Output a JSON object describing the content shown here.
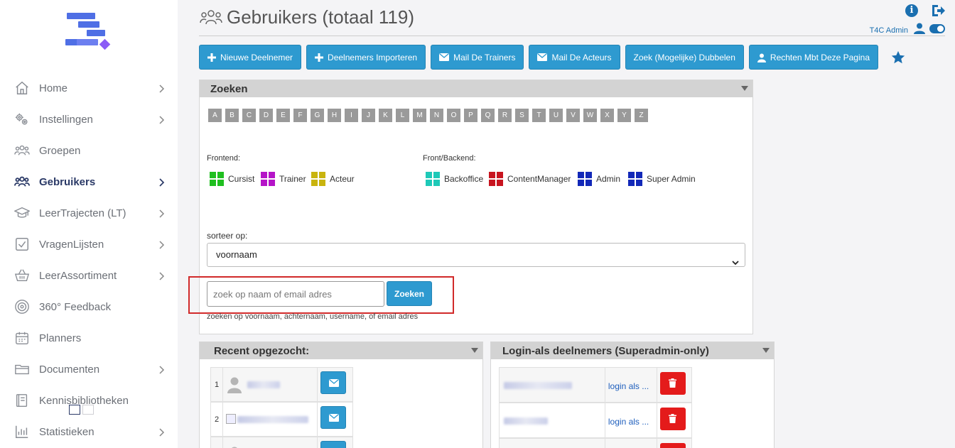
{
  "sidebar": {
    "items": [
      {
        "label": "Home"
      },
      {
        "label": "Instellingen"
      },
      {
        "label": "Groepen"
      },
      {
        "label": "Gebruikers"
      },
      {
        "label": "LeerTrajecten (LT)"
      },
      {
        "label": "VragenLijsten"
      },
      {
        "label": "LeerAssortiment"
      },
      {
        "label": "360° Feedback"
      },
      {
        "label": "Planners"
      },
      {
        "label": "Documenten"
      },
      {
        "label": "Kennisbibliotheken"
      },
      {
        "label": "Statistieken"
      }
    ],
    "active": "Gebruikers"
  },
  "header": {
    "title": "Gebruikers (totaal 119)",
    "user_name": "T4C Admin"
  },
  "toolbar": {
    "buttons": [
      {
        "label": "Nieuwe Deelnemer",
        "icon": "plus-icon"
      },
      {
        "label": "Deelnemers Importeren",
        "icon": "plus-icon"
      },
      {
        "label": "Mail De Trainers",
        "icon": "envelope-icon"
      },
      {
        "label": "Mail De Acteurs",
        "icon": "envelope-icon"
      },
      {
        "label": "Zoek (Mogelijke) Dubbelen",
        "icon": ""
      },
      {
        "label": "Rechten Mbt Deze Pagina",
        "icon": "user-lock-icon"
      }
    ]
  },
  "search_panel": {
    "title": "Zoeken",
    "letters": [
      "A",
      "B",
      "C",
      "D",
      "E",
      "F",
      "G",
      "H",
      "I",
      "J",
      "K",
      "L",
      "M",
      "N",
      "O",
      "P",
      "Q",
      "R",
      "S",
      "T",
      "U",
      "V",
      "W",
      "X",
      "Y",
      "Z"
    ],
    "frontend_label": "Frontend:",
    "frontend_roles": [
      {
        "label": "Cursist",
        "color": "#1fbf1f"
      },
      {
        "label": "Trainer",
        "color": "#b514c8"
      },
      {
        "label": "Acteur",
        "color": "#c9b40e"
      }
    ],
    "backend_label": "Front/Backend:",
    "backend_roles": [
      {
        "label": "Backoffice",
        "color": "#1ec9b8"
      },
      {
        "label": "ContentManager",
        "color": "#c8141f"
      },
      {
        "label": "Admin",
        "color": "#1228b8"
      },
      {
        "label": "Super Admin",
        "color": "#1228b8"
      }
    ],
    "sort_label": "sorteer op:",
    "sort_value": "voornaam",
    "search_placeholder": "zoek op naam of email adres",
    "search_button": "Zoeken",
    "search_hint": "zoeken op voornaam, achternaam, username, of email adres"
  },
  "recent_panel": {
    "title": "Recent opgezocht:",
    "rows": [
      {
        "num": "1"
      },
      {
        "num": "2"
      }
    ]
  },
  "login_panel": {
    "title": "Login-als deelnemers (Superadmin-only)",
    "rows": [
      {
        "link": "login als ..."
      },
      {
        "link": "login als ..."
      }
    ]
  },
  "colors": {
    "primary": "#2e9ad0",
    "danger": "#e41b1b",
    "highlight": "#d12a2a"
  }
}
